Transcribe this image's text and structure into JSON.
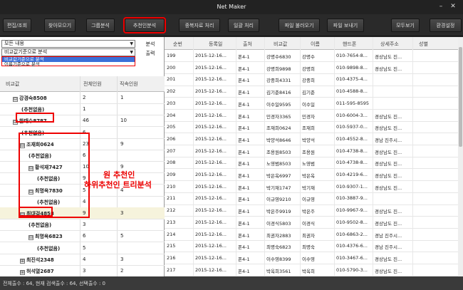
{
  "window": {
    "title": "Net Maker",
    "minimize": "–",
    "close": "✕"
  },
  "toolbar": {
    "buttons": [
      "편집/조회",
      "찾아모으기",
      "그룹분석",
      "추천인분석",
      "중복자료 처리",
      "일괄 처리",
      "파일 불러오기",
      "파일 보내기",
      "모두보기",
      "환경설정"
    ]
  },
  "filters": {
    "combo1": "모든 내용",
    "combo2": "비교값기준으로 분석",
    "dropdown_options": [
      "비교값기준으로 분석",
      "이름기준으로 분석"
    ],
    "analyze_label": "분석",
    "print_label": "출력"
  },
  "tree": {
    "columns": [
      "비교값",
      "전체인원",
      "직속인원"
    ],
    "rows": [
      {
        "label": "강경숙8508",
        "exp": "⊟",
        "total": "2",
        "direct": "1"
      },
      {
        "label": "(추천없음)",
        "exp": "",
        "total": "1",
        "direct": ""
      },
      {
        "label": "한태수8787",
        "exp": "⊟",
        "total": "46",
        "direct": "10"
      },
      {
        "label": "(추천없음)",
        "exp": "",
        "total": "6",
        "direct": ""
      },
      {
        "label": "조재희0624",
        "exp": "⊟",
        "total": "23",
        "direct": "9"
      },
      {
        "label": "(추천없음)",
        "exp": "",
        "total": "6",
        "direct": ""
      },
      {
        "label": "황석재7427",
        "exp": "⊟",
        "total": "10",
        "direct": "9"
      },
      {
        "label": "(추천없음)",
        "exp": "",
        "total": "9",
        "direct": ""
      },
      {
        "label": "최명옥7830",
        "exp": "⊟",
        "total": "5",
        "direct": "4"
      },
      {
        "label": "(추천없음)",
        "exp": "",
        "total": "4",
        "direct": ""
      },
      {
        "label": "최대걸4858",
        "exp": "⊟",
        "total": "9",
        "direct": "3"
      },
      {
        "label": "(추천없음)",
        "exp": "",
        "total": "3",
        "direct": ""
      },
      {
        "label": "최명옥6823",
        "exp": "⊟",
        "total": "6",
        "direct": "5"
      },
      {
        "label": "(추천없음)",
        "exp": "",
        "total": "5",
        "direct": ""
      },
      {
        "label": "최진석2348",
        "exp": "⊞",
        "total": "4",
        "direct": "3"
      },
      {
        "label": "허석열2687",
        "exp": "⊞",
        "total": "3",
        "direct": "2"
      }
    ]
  },
  "annotation": {
    "line1": "원 추천인",
    "line2": "하위추천인 트리분석"
  },
  "grid": {
    "columns": [
      "순번",
      "등록일",
      "출처",
      "비교값",
      "이름",
      "핸드폰",
      "상세주소",
      "성별"
    ],
    "rows": [
      [
        "199",
        "2015-12-16...",
        "폰4-1",
        "강명수6830",
        "강명수",
        "010-7654-8...",
        "경상남도 진...",
        ""
      ],
      [
        "200",
        "2015-12-16...",
        "폰4-1",
        "강명희9898",
        "강명희",
        "010-9898-8...",
        "경상남도 진...",
        ""
      ],
      [
        "201",
        "2015-12-16...",
        "폰4-1",
        "강중희4331",
        "강중희",
        "010-4375-4...",
        "",
        ""
      ],
      [
        "202",
        "2015-12-16...",
        "폰4-1",
        "김기준8416",
        "김기준",
        "010-4588-8...",
        "",
        ""
      ],
      [
        "203",
        "2015-12-16...",
        "폰4-1",
        "이수일9595",
        "이수일",
        "011-595-8595",
        "",
        ""
      ],
      [
        "204",
        "2015-12-16...",
        "폰4-1",
        "민경자3365",
        "민경자",
        "010-6004-3...",
        "경상남도 진...",
        ""
      ],
      [
        "205",
        "2015-12-16...",
        "폰4-1",
        "조재희0624",
        "조재희",
        "010-5937-0...",
        "경상남도 진...",
        ""
      ],
      [
        "206",
        "2015-12-16...",
        "폰4-1",
        "박양석8646",
        "박양석",
        "010-4552-8...",
        "경남 진주시...",
        ""
      ],
      [
        "207",
        "2015-12-16...",
        "폰4-1",
        "조용원8503",
        "조용원",
        "010-4738-8...",
        "경상남도 진...",
        ""
      ],
      [
        "208",
        "2015-12-16...",
        "폰4-1",
        "노영범8503",
        "노영범",
        "010-4738-8...",
        "경상남도 진...",
        ""
      ],
      [
        "209",
        "2015-12-16...",
        "폰4-1",
        "박은옥6997",
        "박은옥",
        "010-4219-6...",
        "경상남도 진...",
        ""
      ],
      [
        "210",
        "2015-12-16...",
        "폰4-1",
        "박기재1747",
        "박기재",
        "010-9307-1...",
        "경상남도 진...",
        ""
      ],
      [
        "211",
        "2015-12-16...",
        "폰4-1",
        "이규영9210",
        "이규영",
        "010-3887-9...",
        "",
        ""
      ],
      [
        "212",
        "2015-12-16...",
        "폰4-1",
        "박은주9919",
        "박은주",
        "010-9967-9...",
        "경상남도 진...",
        ""
      ],
      [
        "213",
        "2015-12-16...",
        "폰4-1",
        "이경식5803",
        "이경식",
        "010-9502-8...",
        "경상남도 진...",
        ""
      ],
      [
        "214",
        "2015-12-16...",
        "폰4-1",
        "최권자2883",
        "최권자",
        "010-6863-2...",
        "경남 진주시...",
        ""
      ],
      [
        "215",
        "2015-12-16...",
        "폰4-1",
        "최명숙6823",
        "최명숙",
        "010-4376-6...",
        "경남 진주시...",
        ""
      ],
      [
        "216",
        "2015-12-16...",
        "폰4-1",
        "이수영8399",
        "이수영",
        "010-3467-6...",
        "경상남도 진...",
        ""
      ],
      [
        "217",
        "2015-12-16...",
        "폰4-1",
        "박옥희3561",
        "박옥희",
        "010-5790-3...",
        "경상남도 진...",
        ""
      ]
    ]
  },
  "status": {
    "text": "전체출수 : 64, 현재 검색출수 : 64, 선택출수 : 0"
  }
}
